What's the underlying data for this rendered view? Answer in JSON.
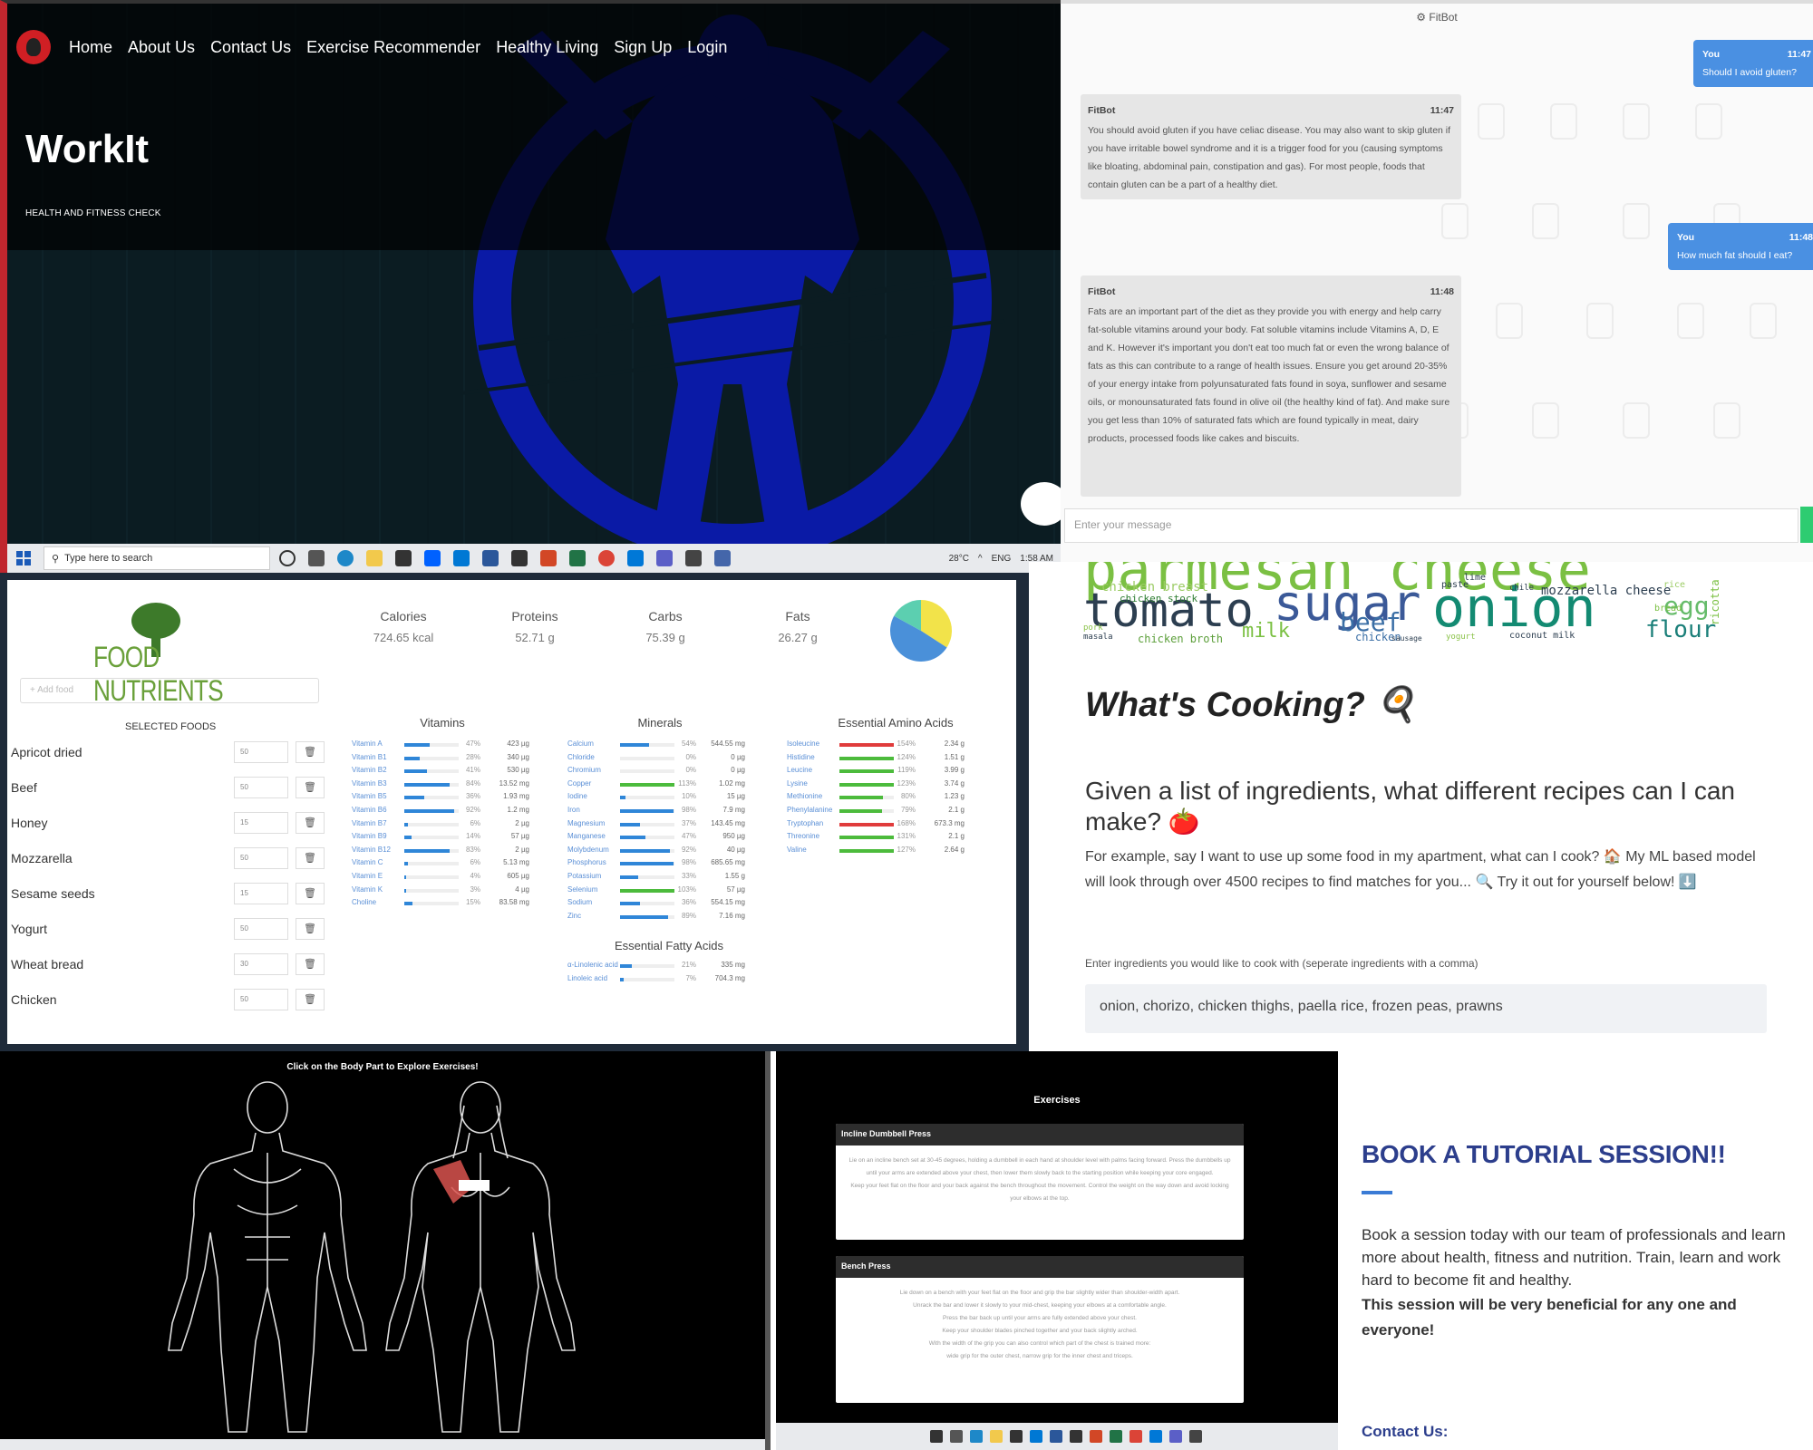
{
  "workit": {
    "nav": [
      "Home",
      "About Us",
      "Contact Us",
      "Exercise Recommender",
      "Healthy Living",
      "Sign Up",
      "Login"
    ],
    "title": "WorkIt",
    "subtitle": "HEALTH AND FITNESS CHECK",
    "taskbar": {
      "search_placeholder": "Type here to search",
      "weather": "28°C",
      "lang": "ENG",
      "time": "1:58 AM"
    }
  },
  "chat": {
    "header": "FitBot",
    "messages": [
      {
        "from": "You",
        "time": "11:47",
        "text": "Should I avoid gluten?",
        "mine": true
      },
      {
        "from": "FitBot",
        "time": "11:47",
        "text": "You should avoid gluten if you have celiac disease. You may also want to skip gluten if you have irritable bowel syndrome and it is a trigger food for you (causing symptoms like bloating, abdominal pain, constipation and gas). For most people, foods that contain gluten can be a part of a healthy diet.",
        "mine": false
      },
      {
        "from": "You",
        "time": "11:48",
        "text": "How much fat should I eat?",
        "mine": true
      },
      {
        "from": "FitBot",
        "time": "11:48",
        "text": "Fats are an important part of the diet as they provide you with energy and help carry fat-soluble vitamins around your body. Fat soluble vitamins include Vitamins A, D, E and K. However it's important you don't eat too much fat or even the wrong balance of fats as this can contribute to a range of health issues. Ensure you get around 20-35% of your energy intake from polyunsaturated fats found in soya, sunflower and sesame oils, or monounsaturated fats found in olive oil (the healthy kind of fat). And make sure you get less than 10% of saturated fats which are found typically in meat, dairy products, processed foods like cakes and biscuits.",
        "mine": false
      }
    ],
    "input_placeholder": "Enter your message"
  },
  "nutrients": {
    "brand": "FOOD NUTRIENTS",
    "add_food_placeholder": "+ Add food",
    "totals": [
      {
        "label": "Calories",
        "value": "724.65 kcal"
      },
      {
        "label": "Proteins",
        "value": "52.71 g"
      },
      {
        "label": "Carbs",
        "value": "75.39 g"
      },
      {
        "label": "Fats",
        "value": "26.27 g"
      }
    ],
    "macro_colors": {
      "proteins": "#f2e34a",
      "carbs": "#4a90d9",
      "fats": "#5ccfb0"
    },
    "selected_header": "SELECTED FOODS",
    "foods": [
      {
        "name": "Apricot dried",
        "qty": "50"
      },
      {
        "name": "Beef",
        "qty": "50"
      },
      {
        "name": "Honey",
        "qty": "15"
      },
      {
        "name": "Mozzarella",
        "qty": "50"
      },
      {
        "name": "Sesame seeds",
        "qty": "15"
      },
      {
        "name": "Yogurt",
        "qty": "50"
      },
      {
        "name": "Wheat bread",
        "qty": "30"
      },
      {
        "name": "Chicken",
        "qty": "50"
      }
    ],
    "vitamins_header": "Vitamins",
    "vitamins": [
      {
        "n": "Vitamin A",
        "p": 47,
        "a": "423 µg"
      },
      {
        "n": "Vitamin B1",
        "p": 28,
        "a": "340 µg"
      },
      {
        "n": "Vitamin B2",
        "p": 41,
        "a": "530 µg"
      },
      {
        "n": "Vitamin B3",
        "p": 84,
        "a": "13.52 mg"
      },
      {
        "n": "Vitamin B5",
        "p": 36,
        "a": "1.93 mg"
      },
      {
        "n": "Vitamin B6",
        "p": 92,
        "a": "1.2 mg"
      },
      {
        "n": "Vitamin B7",
        "p": 6,
        "a": "2 µg"
      },
      {
        "n": "Vitamin B9",
        "p": 14,
        "a": "57 µg"
      },
      {
        "n": "Vitamin B12",
        "p": 83,
        "a": "2 µg"
      },
      {
        "n": "Vitamin C",
        "p": 6,
        "a": "5.13 mg"
      },
      {
        "n": "Vitamin E",
        "p": 4,
        "a": "605 µg"
      },
      {
        "n": "Vitamin K",
        "p": 3,
        "a": "4 µg"
      },
      {
        "n": "Choline",
        "p": 15,
        "a": "83.58 mg"
      }
    ],
    "minerals_header": "Minerals",
    "minerals": [
      {
        "n": "Calcium",
        "p": 54,
        "a": "544.55 mg"
      },
      {
        "n": "Chloride",
        "p": 0,
        "a": "0 µg"
      },
      {
        "n": "Chromium",
        "p": 0,
        "a": "0 µg"
      },
      {
        "n": "Copper",
        "p": 113,
        "a": "1.02 mg"
      },
      {
        "n": "Iodine",
        "p": 10,
        "a": "15 µg"
      },
      {
        "n": "Iron",
        "p": 98,
        "a": "7.9 mg"
      },
      {
        "n": "Magnesium",
        "p": 37,
        "a": "143.45 mg"
      },
      {
        "n": "Manganese",
        "p": 47,
        "a": "950 µg"
      },
      {
        "n": "Molybdenum",
        "p": 92,
        "a": "40 µg"
      },
      {
        "n": "Phosphorus",
        "p": 98,
        "a": "685.65 mg"
      },
      {
        "n": "Potassium",
        "p": 33,
        "a": "1.55 g"
      },
      {
        "n": "Selenium",
        "p": 103,
        "a": "57 µg"
      },
      {
        "n": "Sodium",
        "p": 36,
        "a": "554.15 mg"
      },
      {
        "n": "Zinc",
        "p": 89,
        "a": "7.16 mg"
      }
    ],
    "fatty_header": "Essential Fatty Acids",
    "fatty": [
      {
        "n": "α-Linolenic acid",
        "p": 21,
        "a": "335 mg"
      },
      {
        "n": "Linoleic acid",
        "p": 7,
        "a": "704.3 mg"
      }
    ],
    "amino_header": "Essential Amino Acids",
    "amino": [
      {
        "n": "Isoleucine",
        "p": 154,
        "a": "2.34 g"
      },
      {
        "n": "Histidine",
        "p": 124,
        "a": "1.51 g"
      },
      {
        "n": "Leucine",
        "p": 119,
        "a": "3.99 g"
      },
      {
        "n": "Lysine",
        "p": 123,
        "a": "3.74 g"
      },
      {
        "n": "Methionine",
        "p": 80,
        "a": "1.23 g"
      },
      {
        "n": "Phenylalanine",
        "p": 79,
        "a": "2.1 g"
      },
      {
        "n": "Tryptophan",
        "p": 168,
        "a": "673.3 mg"
      },
      {
        "n": "Threonine",
        "p": 131,
        "a": "2.1 g"
      },
      {
        "n": "Valine",
        "p": 127,
        "a": "2.64 g"
      }
    ]
  },
  "cooking": {
    "cloud": [
      {
        "w": "parmesan cheese",
        "c": "#7bc043",
        "s": 62
      },
      {
        "w": "tomato",
        "c": "#2c3e50",
        "s": 52
      },
      {
        "w": "sugar",
        "c": "#3b5998",
        "s": 54
      },
      {
        "w": "onion",
        "c": "#138a72",
        "s": 60
      },
      {
        "w": "beef",
        "c": "#3a6ea5",
        "s": 28
      },
      {
        "w": "milk",
        "c": "#7bc043",
        "s": 22
      },
      {
        "w": "flour",
        "c": "#1b7f79",
        "s": 26
      },
      {
        "w": "egg",
        "c": "#66bb6a",
        "s": 28
      },
      {
        "w": "chicken breast",
        "c": "#9ccc65",
        "s": 14
      },
      {
        "w": "chicken stock",
        "c": "#2e7d32",
        "s": 11
      },
      {
        "w": "mozzarella cheese",
        "c": "#2c3e50",
        "s": 14
      },
      {
        "w": "chicken broth",
        "c": "#5c9f3a",
        "s": 12
      },
      {
        "w": "coconut milk",
        "c": "#2c3e50",
        "s": 10
      },
      {
        "w": "yogurt",
        "c": "#8bc34a",
        "s": 9
      },
      {
        "w": "chicken",
        "c": "#3a6ea5",
        "s": 12
      },
      {
        "w": "masala",
        "c": "#2c3e50",
        "s": 9
      },
      {
        "w": "sausage",
        "c": "#2c3e50",
        "s": 8
      },
      {
        "w": "paste",
        "c": "#2c3e50",
        "s": 10
      },
      {
        "w": "rice",
        "c": "#9ccc65",
        "s": 10
      },
      {
        "w": "ricotta",
        "c": "#7bc043",
        "s": 12
      },
      {
        "w": "lime",
        "c": "#2c3e50",
        "s": 10
      },
      {
        "w": "chile",
        "c": "#2c3e50",
        "s": 9
      },
      {
        "w": "pork",
        "c": "#8bc34a",
        "s": 9
      },
      {
        "w": "bread",
        "c": "#7bc043",
        "s": 10
      }
    ],
    "title": "What's Cooking? 🍳",
    "question": "Given a list of ingredients, what different recipes can I can make? 🍅",
    "description": "For example, say I want to use up some food in my apartment, what can I cook? 🏠 My ML based model will look through over 4500 recipes to find matches for you... 🔍 Try it out for yourself below! ⬇️",
    "input_label": "Enter ingredients you would like to cook with (seperate ingredients with a comma)",
    "ingredients_value": "onion, chorizo, chicken thighs, paella rice, frozen peas, prawns"
  },
  "bodymap": {
    "caption": "Click on the Body Part to Explore Exercises!"
  },
  "exercises": {
    "caption": "Exercises",
    "cards": [
      {
        "title": "Incline Dumbbell Press",
        "text": "Lie on an incline bench set at 30-45 degrees, holding a dumbbell in each hand at shoulder level with palms facing forward. Press the dumbbells up until your arms are extended above your chest, then lower them slowly back to the starting position while keeping your core engaged.<br>Keep your feet flat on the floor and your back against the bench throughout the movement. Control the weight on the way down and avoid locking your elbows at the top."
      },
      {
        "title": "Bench Press",
        "text": "Lie down on a bench with your feet flat on the floor and grip the bar slightly wider than shoulder-width apart.<br>Unrack the bar and lower it slowly to your mid-chest, keeping your elbows at a comfortable angle.<br>Press the bar back up until your arms are fully extended above your chest.<br>Keep your shoulder blades pinched together and your back slightly arched.<br>With the width of the grip you can also control which part of the chest is trained more:<br>wide grip for the outer chest, narrow grip for the inner chest and triceps."
      }
    ]
  },
  "tutorial": {
    "heading": "BOOK A TUTORIAL SESSION!!",
    "para1": "Book a session today with our team of professionals and learn more about health, fitness and nutrition. Train, learn and work hard to become fit and healthy.",
    "para2": "This session will be very beneficial for any one and everyone!",
    "contact": "Contact Us:"
  }
}
